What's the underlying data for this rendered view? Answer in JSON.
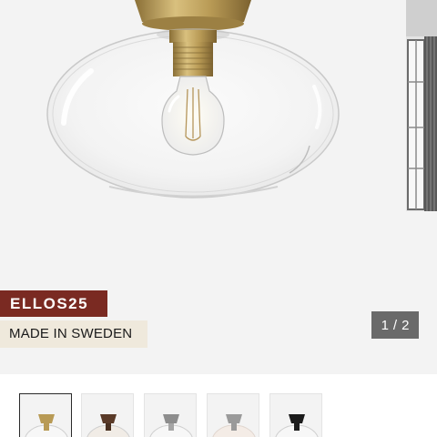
{
  "badges": {
    "code": "ELLOS25",
    "origin": "MADE IN SWEDEN"
  },
  "pager": {
    "current": "1",
    "separator": "/",
    "total": "2"
  },
  "thumbnails": [
    {
      "name": "brass",
      "selected": true,
      "cap_color": "#b89a55"
    },
    {
      "name": "brown",
      "selected": false,
      "cap_color": "#5a3a28"
    },
    {
      "name": "chrome",
      "selected": false,
      "cap_color": "#8d8d8d"
    },
    {
      "name": "opal-silver",
      "selected": false,
      "cap_color": "#9a9a9a"
    },
    {
      "name": "black",
      "selected": false,
      "cap_color": "#1b1b1b"
    }
  ],
  "colors": {
    "code_badge_bg": "#7a2a22",
    "origin_badge_bg": "#efe9dc",
    "pager_bg": "#6a6a6a",
    "brass": "#b89a55"
  }
}
